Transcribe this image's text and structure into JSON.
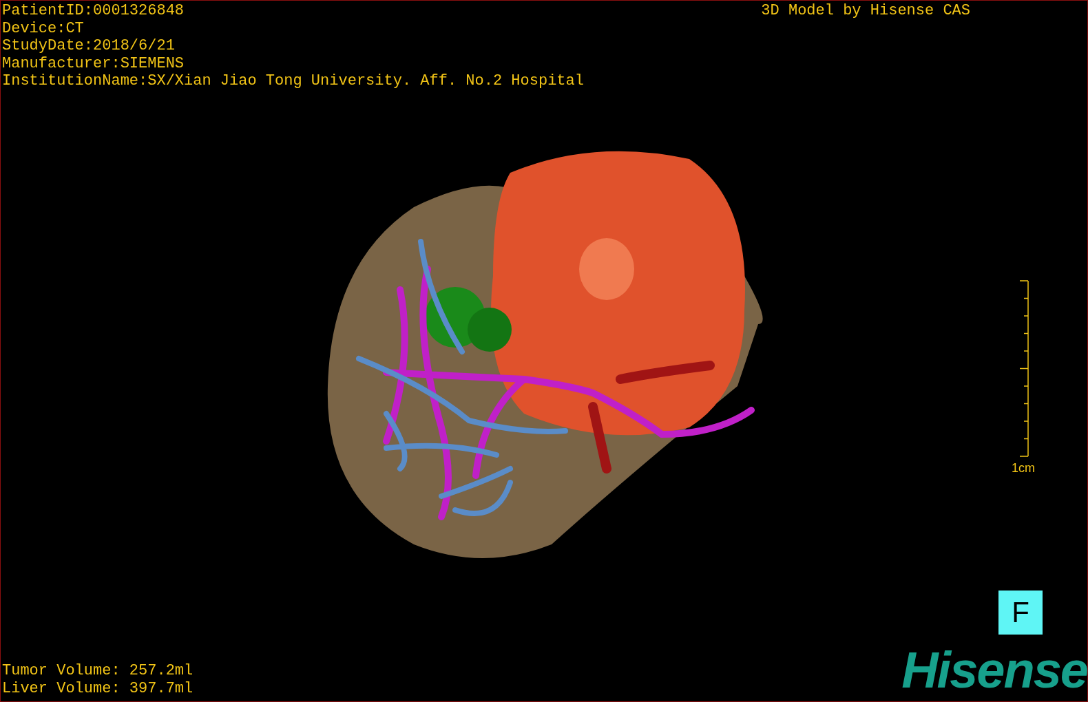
{
  "patient_info": [
    "PatientID:0001326848",
    "Device:CT",
    "StudyDate:2018/6/21",
    "Manufacturer:SIEMENS",
    "InstitutionName:SX/Xian Jiao Tong University. Aff. No.2 Hospital"
  ],
  "credit": "3D Model by Hisense CAS",
  "scale": {
    "label": "1cm"
  },
  "orientation_marker": "F",
  "volumes": [
    "Tumor Volume: 257.2ml",
    "Liver Volume: 397.7ml"
  ],
  "logo": "Hisense"
}
